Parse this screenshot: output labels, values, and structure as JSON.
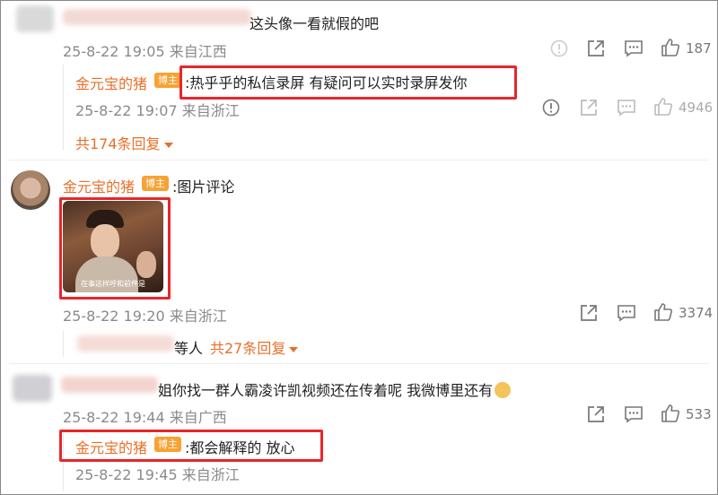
{
  "comments": [
    {
      "text_tail": "这头像一看就假的吧",
      "meta": "25-8-22 19:05 来自江西",
      "like_count": "187",
      "reply": {
        "name": "金元宝的猪",
        "badge": "博主",
        "text": ":热乎乎的私信录屏 有疑问可以实时录屏发你",
        "meta": "25-8-22 19:07 来自浙江",
        "like_count": "4946"
      },
      "more_replies": "共174条回复"
    },
    {
      "name": "金元宝的猪",
      "badge": "博主",
      "text": ":图片评论",
      "image_caption": "在事这样呼和前件是",
      "meta": "25-8-22 19:20 来自浙江",
      "like_count": "3374",
      "reply_tail": "等人",
      "more_replies": "共27条回复"
    },
    {
      "text_tail": "姐你找一群人霸凌许凯视频还在传着呢 我微博里还有",
      "meta": "25-8-22 19:44 来自广西",
      "like_count": "533",
      "reply": {
        "name": "金元宝的猪",
        "badge": "博主",
        "text": ":都会解释的 放心",
        "meta": "25-8-22 19:45 来自浙江"
      }
    }
  ],
  "icons": {
    "report": "report-icon",
    "share": "share-icon",
    "comment": "comment-icon",
    "like": "like-icon"
  },
  "colors": {
    "name": "#e8702a",
    "badge": "#f7a233",
    "highlight": "#e8262b",
    "meta": "#8a8a8a"
  }
}
